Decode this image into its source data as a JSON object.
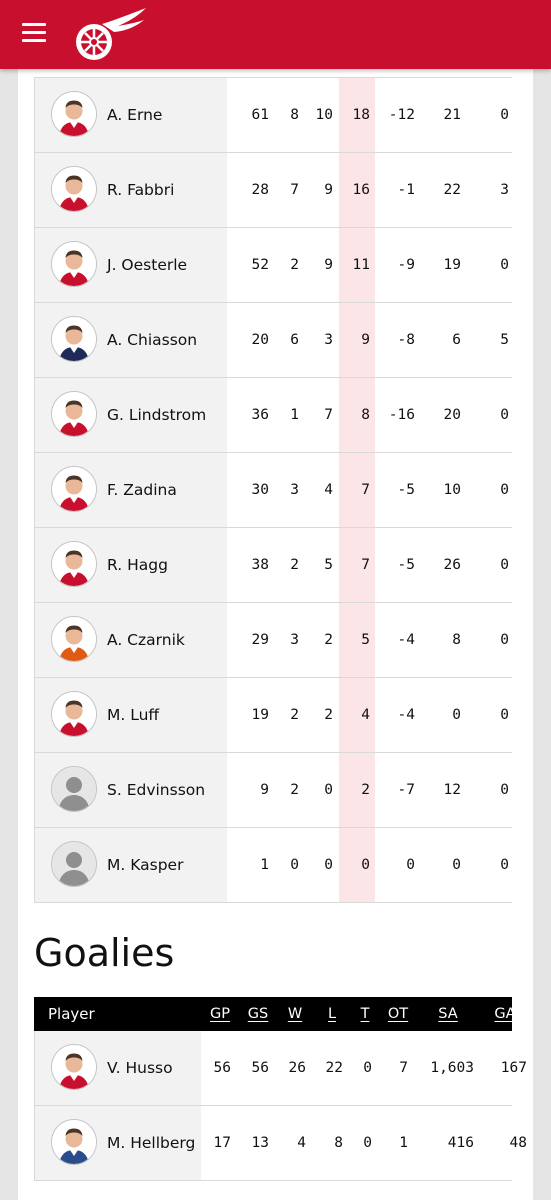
{
  "brand": {
    "accent": "#c8102e",
    "logo": "red-wings-winged-wheel-logo"
  },
  "header": {
    "menu_icon": "hamburger-menu-icon"
  },
  "skaters": [
    {
      "name": "A. Erne",
      "gp": "61",
      "g": "8",
      "a": "10",
      "p": "18",
      "pm": "-12",
      "pim": "21",
      "ppg": "0",
      "jersey": "home"
    },
    {
      "name": "R. Fabbri",
      "gp": "28",
      "g": "7",
      "a": "9",
      "p": "16",
      "pm": "-1",
      "pim": "22",
      "ppg": "3",
      "jersey": "home"
    },
    {
      "name": "J. Oesterle",
      "gp": "52",
      "g": "2",
      "a": "9",
      "p": "11",
      "pm": "-9",
      "pim": "19",
      "ppg": "0",
      "jersey": "home"
    },
    {
      "name": "A. Chiasson",
      "gp": "20",
      "g": "6",
      "a": "3",
      "p": "9",
      "pm": "-8",
      "pim": "6",
      "ppg": "5",
      "jersey": "away"
    },
    {
      "name": "G. Lindstrom",
      "gp": "36",
      "g": "1",
      "a": "7",
      "p": "8",
      "pm": "-16",
      "pim": "20",
      "ppg": "0",
      "jersey": "home"
    },
    {
      "name": "F. Zadina",
      "gp": "30",
      "g": "3",
      "a": "4",
      "p": "7",
      "pm": "-5",
      "pim": "10",
      "ppg": "0",
      "jersey": "home"
    },
    {
      "name": "R. Hagg",
      "gp": "38",
      "g": "2",
      "a": "5",
      "p": "7",
      "pm": "-5",
      "pim": "26",
      "ppg": "0",
      "jersey": "home"
    },
    {
      "name": "A. Czarnik",
      "gp": "29",
      "g": "3",
      "a": "2",
      "p": "5",
      "pm": "-4",
      "pim": "8",
      "ppg": "0",
      "jersey": "orange"
    },
    {
      "name": "M. Luff",
      "gp": "19",
      "g": "2",
      "a": "2",
      "p": "4",
      "pm": "-4",
      "pim": "0",
      "ppg": "0",
      "jersey": "home"
    },
    {
      "name": "S. Edvinsson",
      "gp": "9",
      "g": "2",
      "a": "0",
      "p": "2",
      "pm": "-7",
      "pim": "12",
      "ppg": "0",
      "jersey": "silhouette"
    },
    {
      "name": "M. Kasper",
      "gp": "1",
      "g": "0",
      "a": "0",
      "p": "0",
      "pm": "0",
      "pim": "0",
      "ppg": "0",
      "jersey": "silhouette"
    }
  ],
  "goalies": {
    "title": "Goalies",
    "headers": [
      "Player",
      "GP",
      "GS",
      "W",
      "L",
      "T",
      "OT",
      "SA",
      "GA"
    ],
    "rows": [
      {
        "name": "V. Husso",
        "gp": "56",
        "gs": "56",
        "w": "26",
        "l": "22",
        "t": "0",
        "ot": "7",
        "sa": "1,603",
        "ga": "167",
        "jersey": "home"
      },
      {
        "name": "M. Hellberg",
        "gp": "17",
        "gs": "13",
        "w": "4",
        "l": "8",
        "t": "0",
        "ot": "1",
        "sa": "416",
        "ga": "48",
        "jersey": "blue"
      }
    ]
  }
}
